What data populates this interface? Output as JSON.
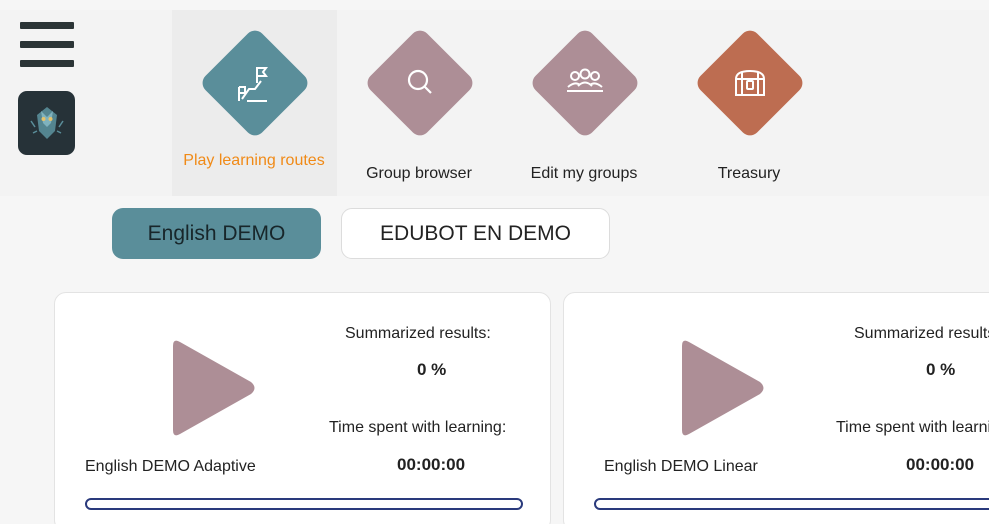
{
  "nav": {
    "items": [
      {
        "label": "Play learning routes",
        "active": true,
        "color": "#5a8e9a",
        "icon": "learning-route-flag-icon"
      },
      {
        "label": "Group browser",
        "active": false,
        "color": "#ad8e96",
        "icon": "search-icon"
      },
      {
        "label": "Edit my groups",
        "active": false,
        "color": "#ad8e96",
        "icon": "group-people-icon"
      },
      {
        "label": "Treasury",
        "active": false,
        "color": "#bd6d51",
        "icon": "treasure-chest-icon"
      }
    ]
  },
  "groups": [
    {
      "label": "English DEMO",
      "active": true
    },
    {
      "label": "EDUBOT EN DEMO",
      "active": false
    }
  ],
  "cards": [
    {
      "title": "English DEMO Adaptive",
      "results_label": "Summarized results:",
      "results_value": "0 %",
      "time_label": "Time spent with learning:",
      "time_value": "00:00:00",
      "progress": 0
    },
    {
      "title": "English DEMO Linear",
      "results_label": "Summarized results:",
      "results_value": "0 %",
      "time_label": "Time spent with learning:",
      "time_value": "00:00:00",
      "progress": 0
    }
  ],
  "colors": {
    "accent_teal": "#5a8e9a",
    "mauve": "#ad8e96",
    "treasury": "#bd6d51",
    "active_label": "#f08a17",
    "progress_border": "#2a3a7c"
  }
}
